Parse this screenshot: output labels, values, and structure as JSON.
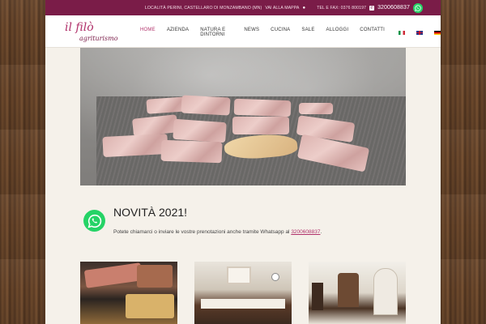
{
  "topbar": {
    "address": "LOCALITÀ PERINI, CASTELLARO DI MONZAMBANO (MN)",
    "map_link": "VAI ALLA MAPPA",
    "tel_fax": "TEL E FAX: 0376 800197",
    "mobile": "3200608837"
  },
  "logo": {
    "name": "il filò",
    "tagline": "agriturismo"
  },
  "nav": {
    "items": [
      "HOME",
      "AZIENDA",
      "NATURA E DINTORNI",
      "NEWS",
      "CUCINA",
      "SALE",
      "ALLOGGI",
      "CONTATTI"
    ],
    "active": "HOME"
  },
  "news": {
    "title": "NOVITÀ 2021!",
    "text": "Potete chiamarci o inviare le vostre prenotazioni anche tramite Whatsapp al",
    "phone": "3200608837",
    "end": "."
  },
  "icons": {
    "whatsapp": "whatsapp-icon",
    "map_pin": "map-pin-icon",
    "phone": "phone-icon"
  },
  "colors": {
    "topbar": "#7a1c48",
    "accent": "#b0306a",
    "whatsapp": "#25d366",
    "page_bg": "#f5f1ea"
  }
}
